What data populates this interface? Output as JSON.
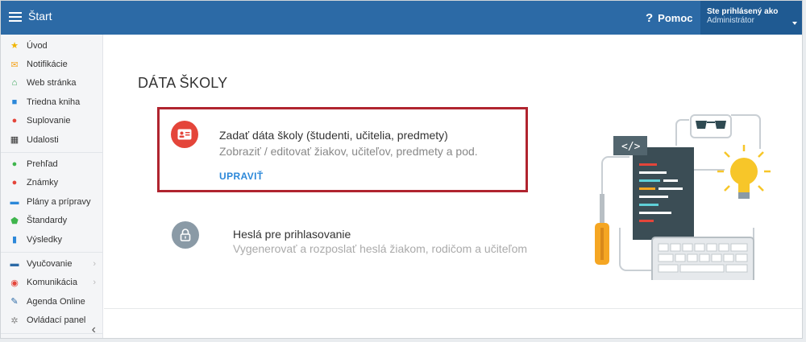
{
  "topbar": {
    "title": "Štart",
    "help_label": "Pomoc",
    "user_line1": "Ste prihlásený ako",
    "user_line2": "Administrátor"
  },
  "sidebar": {
    "groups": [
      [
        {
          "label": "Úvod",
          "icon": "star-icon",
          "color": "#f0b400"
        },
        {
          "label": "Notifikácie",
          "icon": "envelope-icon",
          "color": "#f5a623"
        },
        {
          "label": "Web stránka",
          "icon": "home-icon",
          "color": "#2e9e4f"
        },
        {
          "label": "Triedna kniha",
          "icon": "book-icon",
          "color": "#2c88d9"
        },
        {
          "label": "Suplovanie",
          "icon": "person-icon",
          "color": "#e4453a"
        },
        {
          "label": "Udalosti",
          "icon": "calendar-icon",
          "color": "#333333"
        }
      ],
      [
        {
          "label": "Prehľad",
          "icon": "check-circle-icon",
          "color": "#3fb54d"
        },
        {
          "label": "Známky",
          "icon": "grade-icon",
          "color": "#e4453a"
        },
        {
          "label": "Plány a prípravy",
          "icon": "folder-icon",
          "color": "#2c88d9"
        },
        {
          "label": "Štandardy",
          "icon": "shield-icon",
          "color": "#3fb54d"
        },
        {
          "label": "Výsledky",
          "icon": "bar-chart-icon",
          "color": "#2c88d9"
        }
      ],
      [
        {
          "label": "Vyučovanie",
          "icon": "briefcase-icon",
          "color": "#2c6aa6",
          "arrow": true
        },
        {
          "label": "Komunikácia",
          "icon": "chat-icon",
          "color": "#e4453a",
          "arrow": true
        },
        {
          "label": "Agenda Online",
          "icon": "pen-icon",
          "color": "#2c6aa6"
        },
        {
          "label": "Ovládací panel",
          "icon": "gear-icon",
          "color": "#888888"
        }
      ]
    ]
  },
  "main": {
    "page_title": "DÁTA ŠKOLY",
    "card1": {
      "title": "Zadať dáta školy (študenti, učitelia, predmety)",
      "description": "Zobraziť / editovať žiakov, učiteľov, predmety a pod.",
      "link": "UPRAVIŤ"
    },
    "card2": {
      "title": "Heslá pre prihlasovanie",
      "description": "Vygenerovať a rozposlať heslá žiakom, rodičom a učiteľom"
    }
  },
  "colors": {
    "topbar": "#2c6aa6",
    "accent_red": "#e4453a",
    "link_blue": "#2c88d9",
    "highlight_border": "#b0242f"
  }
}
